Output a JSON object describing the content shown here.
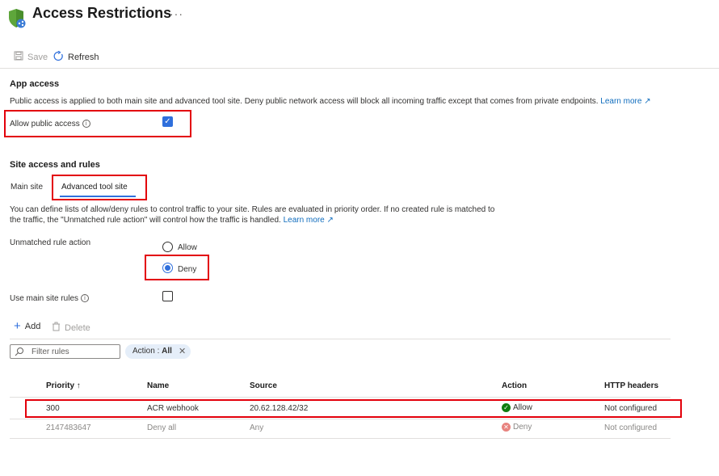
{
  "header": {
    "title": "Access Restrictions",
    "more_label": "···"
  },
  "toolbar": {
    "save_label": "Save",
    "refresh_label": "Refresh"
  },
  "app_access": {
    "section_title": "App access",
    "description": "Public access is applied to both main site and advanced tool site. Deny public network access will block all incoming traffic except that comes from private endpoints.",
    "learn_more": "Learn more",
    "allow_public_access_label": "Allow public access",
    "allow_public_access_checked": true
  },
  "site_access": {
    "section_title": "Site access and rules",
    "tabs": [
      {
        "label": "Main site",
        "selected": false
      },
      {
        "label": "Advanced tool site",
        "selected": true
      }
    ],
    "description_line1": "You can define lists of allow/deny rules to control traffic to your site. Rules are evaluated in priority order. If no created rule is matched to",
    "description_line2": "the traffic, the \"Unmatched rule action\" will control how the traffic is handled.",
    "learn_more": "Learn more",
    "unmatched_rule_label": "Unmatched rule action",
    "unmatched_options": [
      {
        "label": "Allow",
        "selected": false
      },
      {
        "label": "Deny",
        "selected": true
      }
    ],
    "use_main_site_rules_label": "Use main site rules",
    "use_main_site_rules_checked": false
  },
  "rules_toolbar": {
    "add_label": "Add",
    "delete_label": "Delete",
    "filter_placeholder": "Filter rules",
    "filter_pill_key": "Action : ",
    "filter_pill_value": "All"
  },
  "table": {
    "headers": {
      "priority": "Priority",
      "sort_indicator": "↑",
      "name": "Name",
      "source": "Source",
      "action": "Action",
      "http_headers": "HTTP headers"
    },
    "rows": [
      {
        "priority": "300",
        "name": "ACR webhook",
        "source": "20.62.128.42/32",
        "action": "Allow",
        "http_headers": "Not configured"
      },
      {
        "priority": "2147483647",
        "name": "Deny all",
        "source": "Any",
        "action": "Deny",
        "http_headers": "Not configured"
      }
    ]
  },
  "colors": {
    "accent": "#2f6fdc",
    "highlight": "#e3000b",
    "allow": "#107c10",
    "deny": "#e8837f"
  }
}
